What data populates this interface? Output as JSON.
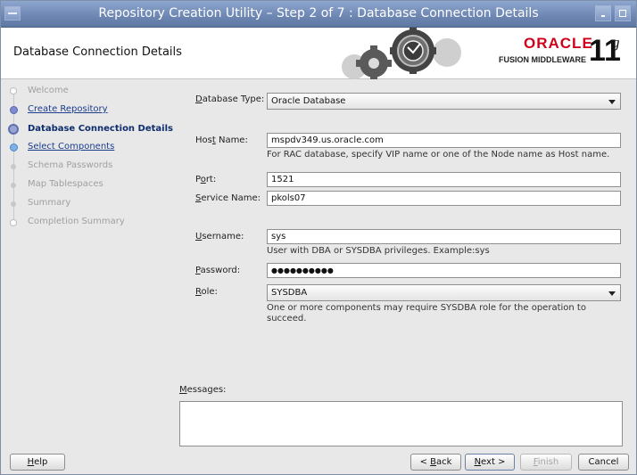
{
  "window": {
    "title": "Repository Creation Utility – Step 2 of 7 : Database Connection Details"
  },
  "header": {
    "page_title": "Database Connection Details",
    "brand_oracle": "ORACLE",
    "brand_sub": "FUSION MIDDLEWARE",
    "brand_version": "11",
    "brand_version_sup": "g"
  },
  "nav": {
    "items": [
      {
        "label": "Welcome",
        "state": "future"
      },
      {
        "label": "Create Repository",
        "state": "done"
      },
      {
        "label": "Database Connection Details",
        "state": "current"
      },
      {
        "label": "Select Components",
        "state": "done"
      },
      {
        "label": "Schema Passwords",
        "state": "future"
      },
      {
        "label": "Map Tablespaces",
        "state": "future"
      },
      {
        "label": "Summary",
        "state": "future"
      },
      {
        "label": "Completion Summary",
        "state": "future"
      }
    ]
  },
  "form": {
    "database_type": {
      "label_pre": "",
      "label_u": "D",
      "label_post": "atabase Type:",
      "value": "Oracle Database"
    },
    "host_name": {
      "label_pre": "Hos",
      "label_u": "t",
      "label_post": " Name:",
      "value": "mspdv349.us.oracle.com",
      "hint": "For RAC database, specify VIP name or one of the Node name as Host name."
    },
    "port": {
      "label_pre": "P",
      "label_u": "o",
      "label_post": "rt:",
      "value": "1521"
    },
    "service_name": {
      "label_pre": "",
      "label_u": "S",
      "label_post": "ervice Name:",
      "value": "pkols07"
    },
    "username": {
      "label_pre": "",
      "label_u": "U",
      "label_post": "sername:",
      "value": "sys",
      "hint": "User with DBA or SYSDBA privileges. Example:sys"
    },
    "password": {
      "label_pre": "",
      "label_u": "P",
      "label_post": "assword:",
      "value": "●●●●●●●●●●"
    },
    "role": {
      "label_pre": "",
      "label_u": "R",
      "label_post": "ole:",
      "value": "SYSDBA",
      "hint": "One or more components may require SYSDBA role for the operation to succeed."
    },
    "messages": {
      "label_pre": "",
      "label_u": "M",
      "label_post": "essages:",
      "value": ""
    }
  },
  "buttons": {
    "help": {
      "pre": "",
      "u": "H",
      "post": "elp"
    },
    "back": {
      "pre": "< ",
      "u": "B",
      "post": "ack"
    },
    "next": {
      "pre": "",
      "u": "N",
      "post": "ext >"
    },
    "finish": {
      "pre": "",
      "u": "F",
      "post": "inish"
    },
    "cancel": {
      "pre": "",
      "u": "",
      "post": "Cancel"
    }
  },
  "colors": {
    "title_bar": "#6d86b2",
    "oracle_red": "#d0021b",
    "nav_link": "#1a3c8c"
  }
}
